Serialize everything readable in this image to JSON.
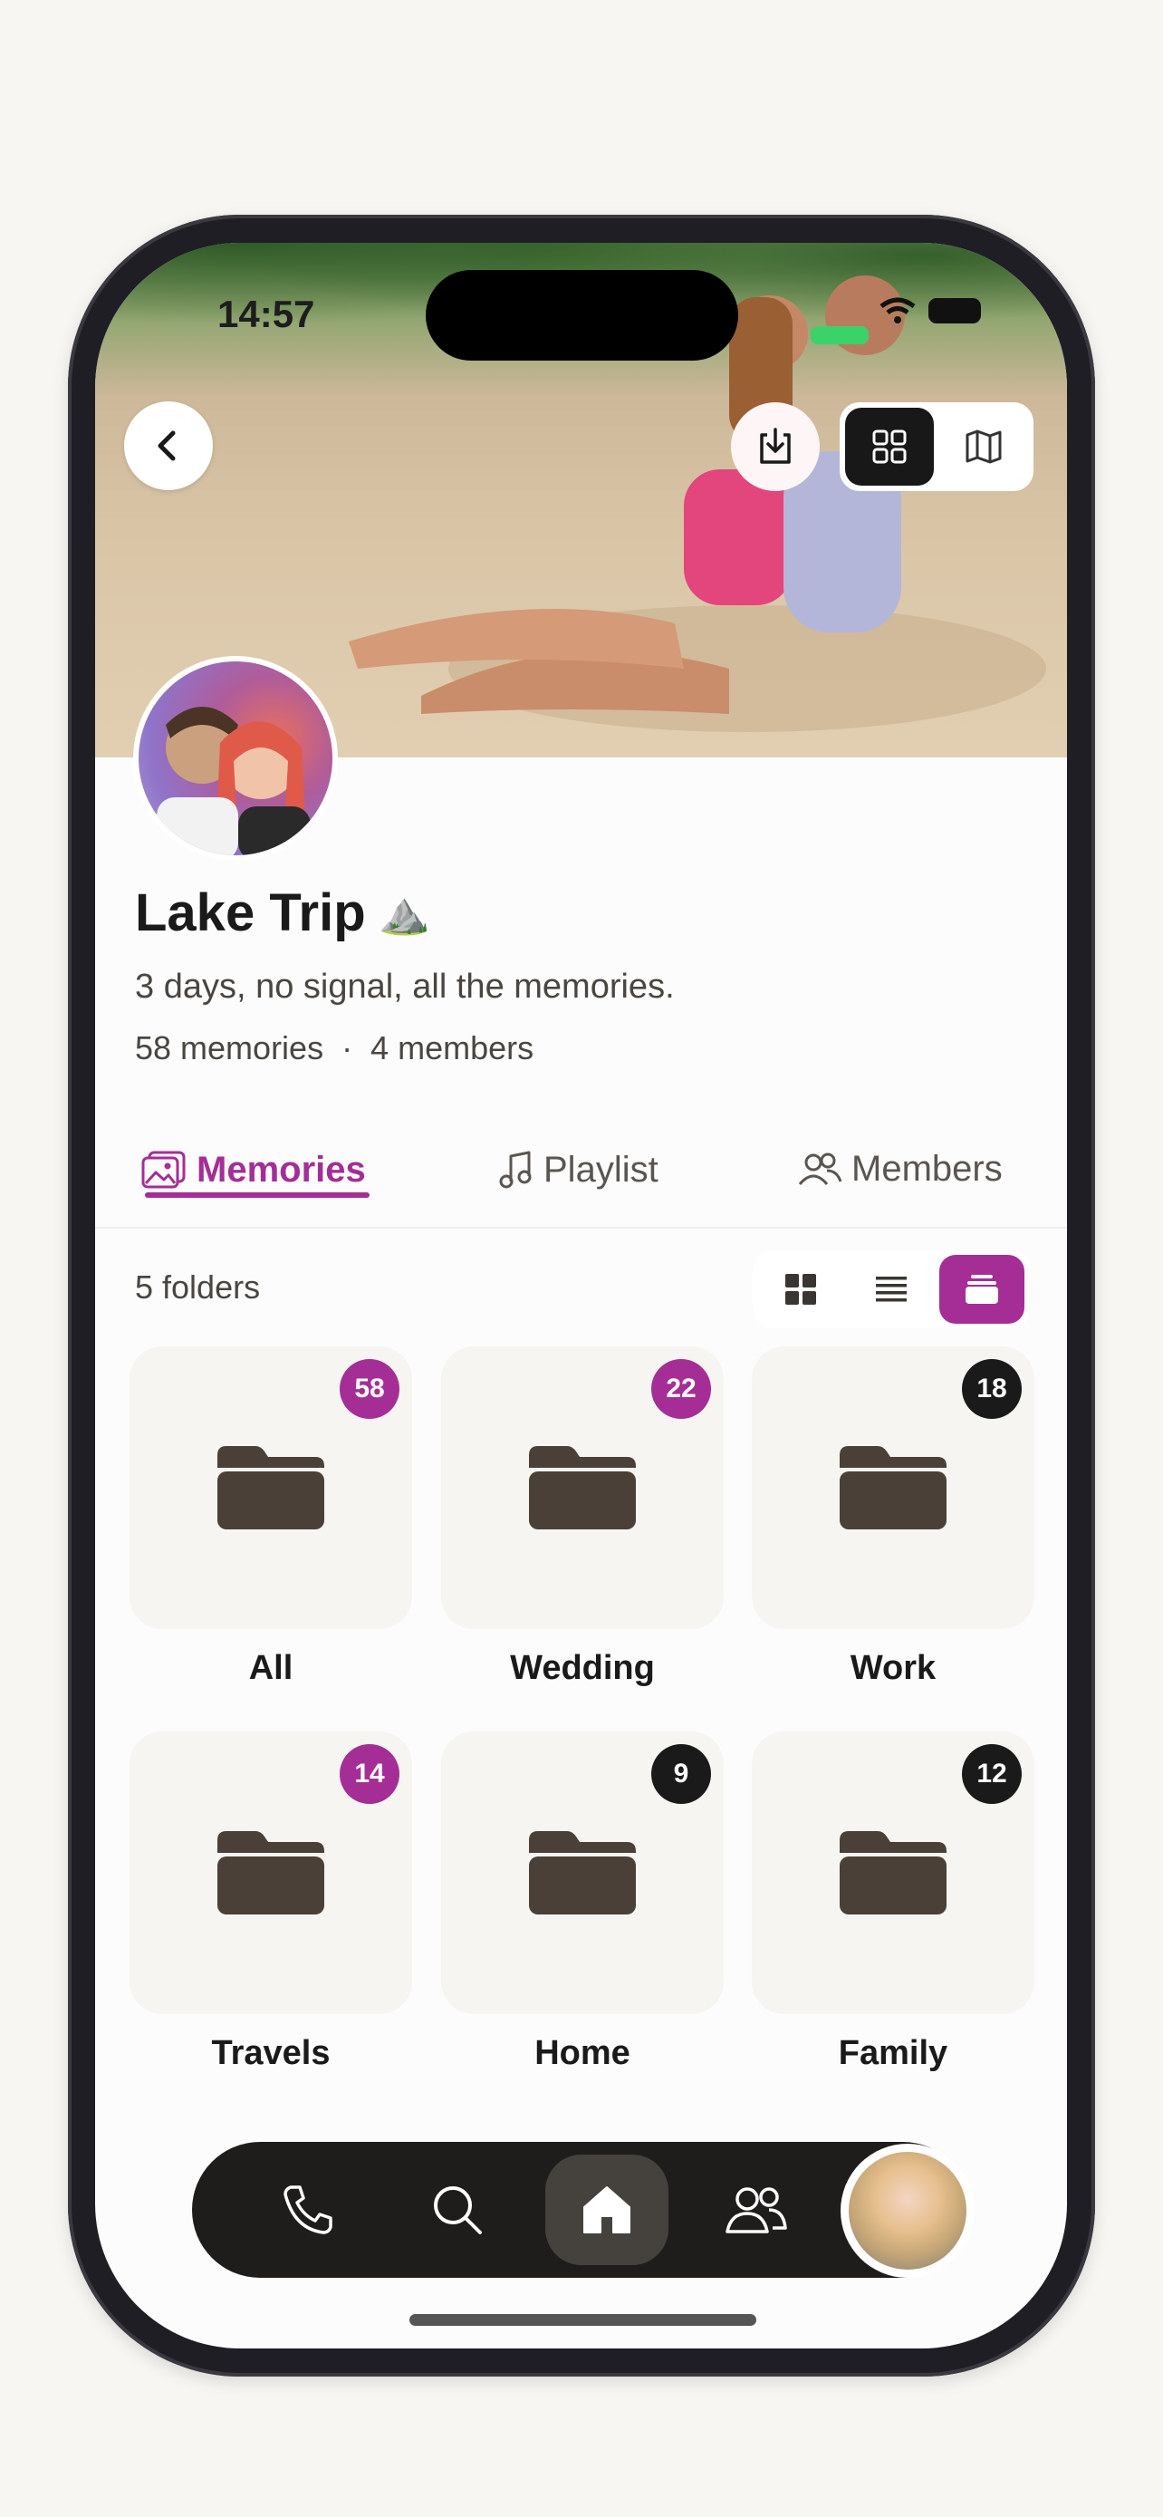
{
  "status": {
    "time": "14:57"
  },
  "header": {
    "back_icon": "chevron-left-icon",
    "download_icon": "download-icon",
    "view_modes": [
      {
        "icon": "grid-icon",
        "active": true
      },
      {
        "icon": "map-icon",
        "active": false
      }
    ]
  },
  "album": {
    "title": "Lake Trip",
    "emoji": "⛰️",
    "subtitle": "3 days, no signal, all the memories.",
    "memories": "58 memories",
    "separator": "·",
    "members": "4 members"
  },
  "tabs": [
    {
      "label": "Memories",
      "icon": "photos-icon",
      "active": true
    },
    {
      "label": "Playlist",
      "icon": "music-note-icon",
      "active": false
    },
    {
      "label": "Members",
      "icon": "people-icon",
      "active": false
    }
  ],
  "folders_toolbar": {
    "count_label": "5 folders",
    "layouts": [
      {
        "icon": "grid-layout-icon",
        "active": false
      },
      {
        "icon": "list-layout-icon",
        "active": false
      },
      {
        "icon": "stack-layout-icon",
        "active": true
      }
    ]
  },
  "folders": [
    {
      "name": "All",
      "count": "58",
      "badge_color": "#a42e96"
    },
    {
      "name": "Wedding",
      "count": "22",
      "badge_color": "#a42e96"
    },
    {
      "name": "Work",
      "count": "18",
      "badge_color": "#1a1a1a"
    },
    {
      "name": "Travels",
      "count": "14",
      "badge_color": "#a42e96"
    },
    {
      "name": "Home",
      "count": "9",
      "badge_color": "#1a1a1a"
    },
    {
      "name": "Family",
      "count": "12",
      "badge_color": "#1a1a1a"
    }
  ],
  "nav": [
    {
      "icon": "phone-icon",
      "active": false
    },
    {
      "icon": "search-icon",
      "active": false
    },
    {
      "icon": "home-icon",
      "active": true
    },
    {
      "icon": "people-icon",
      "active": false
    }
  ],
  "colors": {
    "accent": "#a42e96",
    "dark": "#1f1d1b",
    "folder": "#4a4038"
  }
}
